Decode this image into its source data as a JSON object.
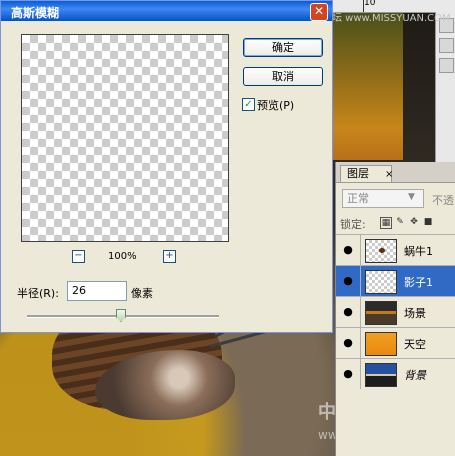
{
  "dialog": {
    "title": "高斯模糊",
    "ok_label": "确定",
    "cancel_label": "取消",
    "preview_checked": true,
    "preview_label": "预览(P)",
    "zoom_out_symbol": "−",
    "zoom_in_symbol": "+",
    "zoom_level": "100%",
    "radius_label": "半径(R):",
    "radius_value": "26",
    "radius_unit": "像素",
    "close_symbol": "✕"
  },
  "layers_panel": {
    "tab_label": "图层",
    "tab_close": "×",
    "blend_mode": "正常",
    "opacity_label": "不透",
    "lock_label": "锁定:",
    "layers": [
      {
        "name": "蜗牛1",
        "visible": true,
        "selected": false,
        "thumb": "checker-snail"
      },
      {
        "name": "影子1",
        "visible": true,
        "selected": true,
        "thumb": "checker"
      },
      {
        "name": "场景",
        "visible": true,
        "selected": false,
        "thumb": "scene"
      },
      {
        "name": "天空",
        "visible": true,
        "selected": false,
        "thumb": "sky"
      },
      {
        "name": "背景",
        "visible": true,
        "selected": false,
        "thumb": "background",
        "italic": true
      }
    ]
  },
  "canvas": {
    "ruler_number": "10",
    "watermark_top": "思缘设计论坛 www.MISSYUAN.COM",
    "watermark_bottom": "中国教程网",
    "watermark_url": "www.jcwcn.com"
  },
  "icons": {
    "eye": "eye-icon",
    "close": "close-icon",
    "check": "checkmark-icon",
    "zoom_out": "zoom-out-icon",
    "zoom_in": "zoom-in-icon"
  },
  "colors": {
    "titlebar": "#0a5bd6",
    "selected_layer": "#316ac5",
    "dialog_bg": "#ece9d8"
  }
}
